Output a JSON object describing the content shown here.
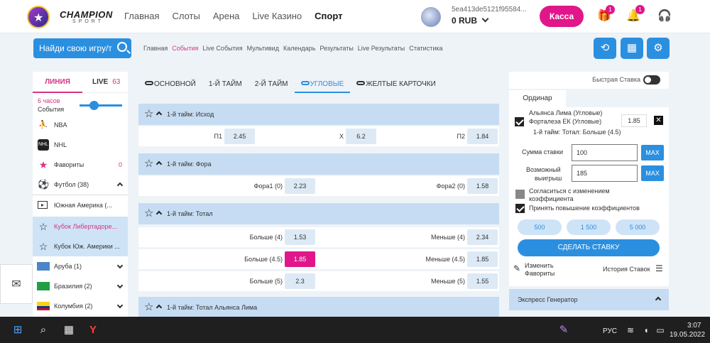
{
  "header": {
    "logo_title": "CHAMPION",
    "logo_sub": "SPORT",
    "nav": [
      "Главная",
      "Слоты",
      "Арена",
      "Live Казино",
      "Спорт"
    ],
    "user_id": "5ea413de5121f95584...",
    "balance": "0 RUB",
    "kassa": "Касса",
    "gift_badge": "1",
    "bell_badge": "1"
  },
  "search": {
    "label": "Найди свою игру/т"
  },
  "subnav": [
    "Главная",
    "События",
    "Live События",
    "Мультивид",
    "Календарь",
    "Результаты",
    "Live Результаты",
    "Статистика"
  ],
  "left": {
    "tab_line": "ЛИНИЯ",
    "tab_live": "LIVE",
    "live_count": "63",
    "hours": "6 часов",
    "events": "События",
    "items": [
      {
        "label": "NBA"
      },
      {
        "label": "NHL"
      },
      {
        "label": "Фавориты",
        "count": "0"
      },
      {
        "label": "Футбол (38)"
      },
      {
        "label": "Южная Америка (..."
      },
      {
        "label": "Кубок Либертадоре..."
      },
      {
        "label": "Кубок Юж. Америки ..."
      },
      {
        "label": "Аруба (1)"
      },
      {
        "label": "Бразилия (2)"
      },
      {
        "label": "Колумбия (2)"
      }
    ]
  },
  "center": {
    "tabs": [
      "ОСНОВНОЙ",
      "1-Й ТАЙМ",
      "2-Й ТАЙМ",
      "УГЛОВЫЕ",
      "ЖЕЛТЫЕ КАРТОЧКИ"
    ],
    "markets": [
      {
        "title": "1-й тайм: Исход",
        "rows": [
          {
            "l1": "П1",
            "o1": "2.45",
            "l2": "Х",
            "o2": "6.2",
            "l3": "П2",
            "o3": "1.84"
          }
        ]
      },
      {
        "title": "1-й тайм: Фора",
        "rows": [
          {
            "l1": "Фора1 (0)",
            "o1": "2.23",
            "l2": "Фора2 (0)",
            "o2": "1.58"
          }
        ]
      },
      {
        "title": "1-й тайм: Тотал",
        "rows": [
          {
            "l1": "Больше (4)",
            "o1": "1.53",
            "l2": "Меньше (4)",
            "o2": "2.34"
          },
          {
            "l1": "Больше (4.5)",
            "o1": "1.85",
            "l2": "Меньше (4.5)",
            "o2": "1.85"
          },
          {
            "l1": "Больше (5)",
            "o1": "2.3",
            "l2": "Меньше (5)",
            "o2": "1.55"
          }
        ]
      },
      {
        "title": "1-й тайм: Тотал Альянса Лима",
        "rows": []
      }
    ]
  },
  "right": {
    "fast_bet": "Быстрая Ставка",
    "tab_ordinar": "Ординар",
    "bet_team1": "Альянса Лима (Угловые)",
    "bet_team2": "Форталеза ЕК (Угловые)",
    "bet_market": "1-й тайм: Тотал: Больше (4.5)",
    "bet_odd": "1.85",
    "stake_label": "Сумма ставки",
    "stake_value": "100",
    "win_label_1": "Возможный",
    "win_label_2": "выигрыш",
    "win_value": "185",
    "max": "MAX",
    "agree_1": "Согласиться с изменением",
    "agree_2": "коэффициента",
    "accept": "Принять повышение коэффициентов",
    "quick": [
      "500",
      "1 500",
      "5 000"
    ],
    "place": "СДЕЛАТЬ СТАВКУ",
    "fav_1": "Изменить",
    "fav_2": "Фавориты",
    "history": "История Ставок",
    "generator": "Экспресс Генератор"
  },
  "taskbar": {
    "lang": "РУС",
    "time": "3:07",
    "date": "19.05.2022"
  },
  "colors": {
    "accent": "#2b8fe0",
    "brand": "#e0168a",
    "market_header": "#c6dcf2"
  }
}
